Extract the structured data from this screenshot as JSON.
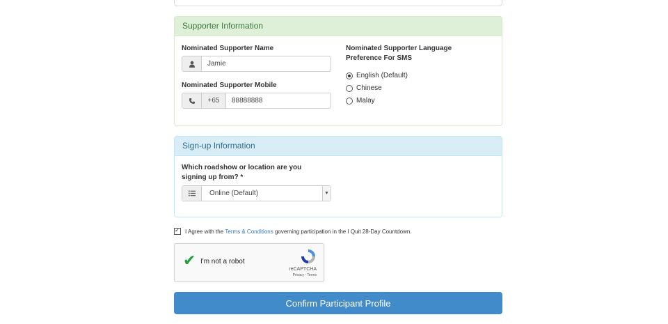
{
  "supporter": {
    "heading": "Supporter Information",
    "name_label": "Nominated Supporter Name",
    "name_value": "Jamie",
    "mobile_label": "Nominated Supporter Mobile",
    "mobile_code": "+65",
    "mobile_value": "88888888",
    "language_label_line1": "Nominated Supporter Language",
    "language_label_line2": "Preference For SMS",
    "language_options": [
      "English (Default)",
      "Chinese",
      "Malay"
    ],
    "language_selected": "English (Default)"
  },
  "signup": {
    "heading": "Sign-up Information",
    "question_line1": "Which roadshow or location are you",
    "question_line2": "signing up from? *",
    "selected_value": "Online (Default)"
  },
  "agreement": {
    "prefix": "I Agree with the ",
    "link": "Terms & Conditions",
    "suffix": " governing participation in the I Quit 28-Day Countdown.",
    "checked": true
  },
  "captcha": {
    "label": "I'm not a robot",
    "brand": "reCAPTCHA",
    "privacy": "Privacy - Terms",
    "checked": true
  },
  "confirm_label": "Confirm Participant Profile",
  "colors": {
    "success_bg": "#dff0d8",
    "info_bg": "#d9edf7",
    "primary": "#428bca",
    "link": "#337ab7"
  }
}
